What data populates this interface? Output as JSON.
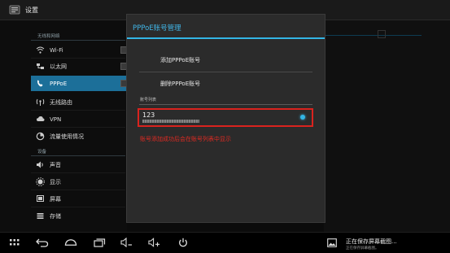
{
  "titlebar": {
    "title": "设置",
    "icon": "settings-app-icon"
  },
  "sidebar": {
    "section_wireless": "无线和网络",
    "section_device": "设备",
    "items": [
      {
        "label": "Wi-Fi",
        "icon": "wifi-icon"
      },
      {
        "label": "以太网",
        "icon": "ethernet-icon"
      },
      {
        "label": "PPPoE",
        "icon": "phone-icon",
        "selected": true
      },
      {
        "label": "无线路由",
        "icon": "router-icon"
      },
      {
        "label": "VPN",
        "icon": "vpn-icon"
      },
      {
        "label": "流量使用情况",
        "icon": "data-usage-icon"
      },
      {
        "label": "声音",
        "icon": "sound-icon"
      },
      {
        "label": "显示",
        "icon": "display-icon"
      },
      {
        "label": "屏幕",
        "icon": "screen-icon"
      },
      {
        "label": "存储",
        "icon": "storage-icon"
      }
    ]
  },
  "dialog": {
    "title": "PPPoE账号管理",
    "add_account": "添加PPPoE账号",
    "delete_account": "删除PPPoE账号",
    "list_header": "账号列表",
    "account": {
      "name": "123",
      "selected": true
    },
    "annotation": "账号添加成功后会在账号列表中显示"
  },
  "navbar": {
    "icons": [
      "apps-icon",
      "back-icon",
      "home-icon",
      "recents-icon",
      "volume-down-icon",
      "volume-up-icon",
      "power-icon"
    ],
    "notification_title": "正在保存屏幕截图...",
    "notification_sub": "正在保存屏幕截图。"
  },
  "colors": {
    "accent": "#33b5e5",
    "selected": "#1c6f99",
    "annotation": "#e02a22"
  }
}
